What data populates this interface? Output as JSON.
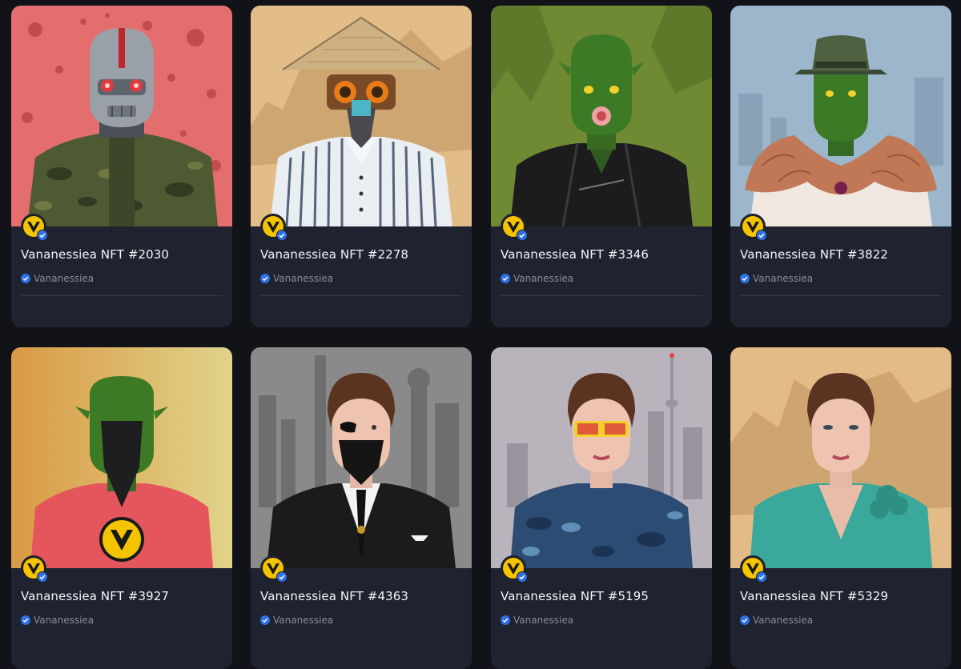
{
  "collection": {
    "creator_name": "Vananessiea",
    "brand_color": "#f5c400",
    "verified_color": "#2f6fe8"
  },
  "cards": [
    {
      "title": "Vananessiea NFT #2030",
      "creator": "Vananessiea",
      "character": "robot-in-camo-jacket",
      "background": "#e46e6e"
    },
    {
      "title": "Vananessiea NFT #2278",
      "creator": "Vananessiea",
      "character": "straw-hat-gasmask-striped-shirt",
      "background": "#e2bd88"
    },
    {
      "title": "Vananessiea NFT #3346",
      "creator": "Vananessiea",
      "character": "green-alien-leather-jacket",
      "background": "#6f8a32"
    },
    {
      "title": "Vananessiea NFT #3822",
      "creator": "Vananessiea",
      "character": "green-alien-fedora-fur-stole",
      "background": "#9cb6cc"
    },
    {
      "title": "Vananessiea NFT #3927",
      "creator": "Vananessiea",
      "character": "green-alien-plague-mask-red-shirt",
      "background": "#d9a453"
    },
    {
      "title": "Vananessiea NFT #4363",
      "creator": "Vananessiea",
      "character": "woman-eyepatch-black-suit",
      "background": "#8a8a8a"
    },
    {
      "title": "Vananessiea NFT #5195",
      "creator": "Vananessiea",
      "character": "woman-yellow-glasses-blue-camo",
      "background": "#b9b3bc"
    },
    {
      "title": "Vananessiea NFT #5329",
      "creator": "Vananessiea",
      "character": "woman-teal-dress",
      "background": "#e2bb86"
    }
  ]
}
